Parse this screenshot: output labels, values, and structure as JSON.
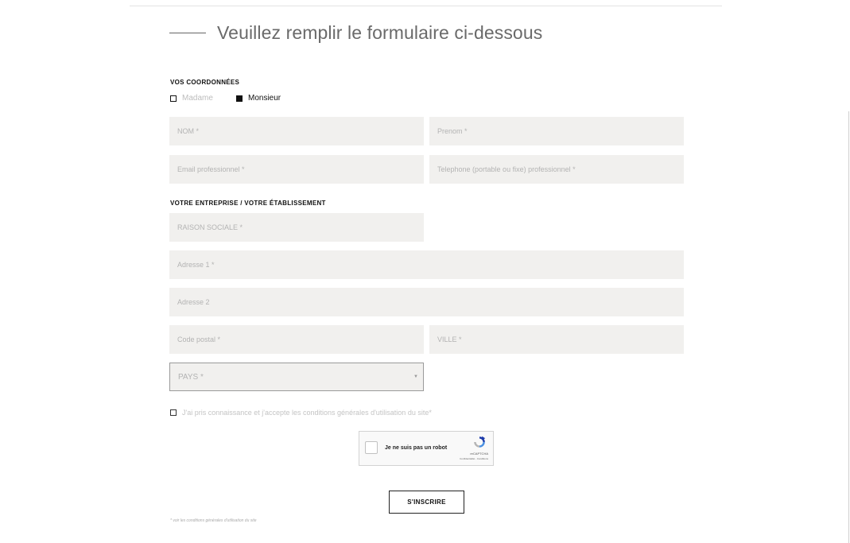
{
  "header": {
    "title": "Veuillez remplir le formulaire ci-dessous"
  },
  "contact": {
    "section_label": "VOS COORDONNÉES",
    "civility": [
      {
        "label": "Madame",
        "selected": false
      },
      {
        "label": "Monsieur",
        "selected": true
      }
    ],
    "nom_placeholder": "NOM *",
    "prenom_placeholder": "Prenom *",
    "email_placeholder": "Email professionnel *",
    "telephone_placeholder": "Telephone (portable ou fixe) professionnel *"
  },
  "company": {
    "section_label": "VOTRE ENTREPRISE / VOTRE ÉTABLISSEMENT",
    "raison_sociale_placeholder": "RAISON SOCIALE *",
    "adresse1_placeholder": "Adresse 1 *",
    "adresse2_placeholder": "Adresse 2",
    "code_postal_placeholder": "Code postal *",
    "ville_placeholder": "VILLE *",
    "pays_selected": "PAYS *"
  },
  "terms": {
    "label": "J'ai pris connaissance et j'accepte les conditions générales d'utilisation du site*",
    "checked": false
  },
  "captcha": {
    "label": "Je ne suis pas un robot",
    "brand": "reCAPTCHA",
    "links": "Confidentialité - Conditions"
  },
  "submit": {
    "label": "S'INSCRIRE"
  },
  "footnote": "* voir les conditions générales d'utilisation du site"
}
